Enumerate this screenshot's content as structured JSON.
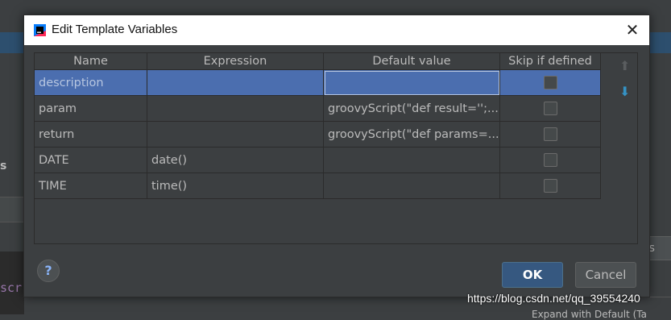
{
  "background": {
    "left_text": "s",
    "left_code": "scr",
    "right_button": "es",
    "bottom_text": "Expand with Default (Ta"
  },
  "dialog": {
    "title": "Edit Template Variables",
    "columns": [
      "Name",
      "Expression",
      "Default value",
      "Skip if defined"
    ],
    "rows": [
      {
        "name": "description",
        "expression": "",
        "default": "",
        "skip": false
      },
      {
        "name": "param",
        "expression": "",
        "default": "groovyScript(\"def result='';...",
        "skip": false
      },
      {
        "name": "return",
        "expression": "",
        "default": "groovyScript(\"def params=...",
        "skip": false
      },
      {
        "name": "DATE",
        "expression": "date()",
        "default": "",
        "skip": false
      },
      {
        "name": "TIME",
        "expression": "time()",
        "default": "",
        "skip": false
      }
    ],
    "help_label": "?",
    "ok_label": "OK",
    "cancel_label": "Cancel",
    "icons": {
      "close": "close-icon",
      "up": "move-up-icon",
      "down": "move-down-icon",
      "app": "intellij-icon"
    }
  },
  "watermark": "https://blog.csdn.net/qq_39554240",
  "colors": {
    "selection": "#4b6eaf",
    "ok": "#365880",
    "down_arrow": "#3592c4"
  }
}
